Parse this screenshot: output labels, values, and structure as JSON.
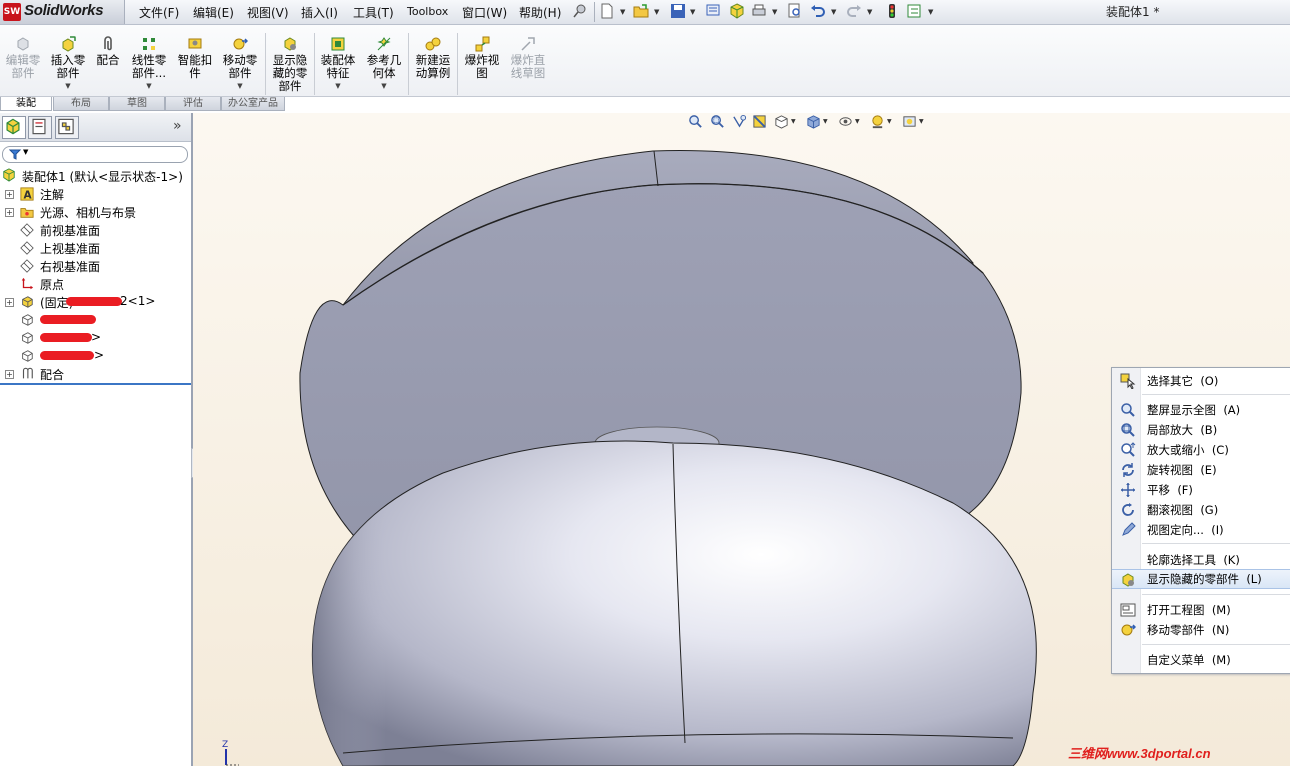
{
  "app": {
    "brand": "SolidWorks",
    "document_title": "装配体1 *"
  },
  "menus": [
    "文件(F)",
    "编辑(E)",
    "视图(V)",
    "插入(I)",
    "工具(T)",
    "Toolbox",
    "窗口(W)",
    "帮助(H)"
  ],
  "commands": [
    {
      "label": "编辑零\n部件",
      "disabled": true
    },
    {
      "label": "插入零\n部件",
      "dropdown": true
    },
    {
      "label": "配合"
    },
    {
      "label": "线性零\n部件...",
      "dropdown": true
    },
    {
      "label": "智能扣\n件"
    },
    {
      "label": "移动零\n部件",
      "dropdown": true
    },
    {
      "label": "显示隐\n藏的零\n部件"
    },
    {
      "label": "装配体\n特征",
      "dropdown": true
    },
    {
      "label": "参考几\n何体",
      "dropdown": true
    },
    {
      "label": "新建运\n动算例"
    },
    {
      "label": "爆炸视\n图"
    },
    {
      "label": "爆炸直\n线草图",
      "disabled": true
    }
  ],
  "command_tabs": [
    "装配",
    "布局",
    "草图",
    "评估",
    "办公室产品"
  ],
  "feature_tree": {
    "root": "装配体1 (默认<显示状态-1>)",
    "items": [
      "注解",
      "光源、相机与布景",
      "前视基准面",
      "上视基准面",
      "右视基准面",
      "原点",
      "(固定)",
      "2<1>",
      ">",
      ">",
      "配合"
    ]
  },
  "panel_expand": "»",
  "context_menu": [
    {
      "label": "选择其它",
      "key": "(O)"
    },
    {
      "label": "整屏显示全图",
      "key": "(A)"
    },
    {
      "label": "局部放大",
      "key": "(B)"
    },
    {
      "label": "放大或缩小",
      "key": "(C)"
    },
    {
      "label": "旋转视图",
      "key": "(E)"
    },
    {
      "label": "平移",
      "key": "(F)"
    },
    {
      "label": "翻滚视图",
      "key": "(G)"
    },
    {
      "label": "视图定向...",
      "key": "(I)"
    },
    {
      "label": "轮廓选择工具",
      "key": "(K)"
    },
    {
      "label": "显示隐藏的零部件",
      "key": "(L)"
    },
    {
      "label": "打开工程图",
      "key": "(M)"
    },
    {
      "label": "移动零部件",
      "key": "(N)"
    },
    {
      "label": "自定义菜单",
      "key": "(M)"
    }
  ],
  "watermark": "三维网www.3dportal.cn",
  "colors": {
    "accent_blue": "#3b76c5",
    "highlight": "#d9e6f6",
    "model_gray": "#9b9fb2",
    "brand_red": "#c8141c"
  }
}
